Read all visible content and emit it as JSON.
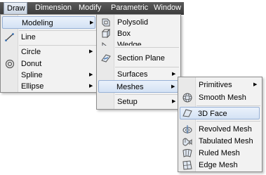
{
  "menubar": {
    "items": [
      {
        "label": "Draw"
      },
      {
        "label": "Dimension"
      },
      {
        "label": "Modify"
      },
      {
        "label": "Parametric"
      },
      {
        "label": "Window"
      }
    ]
  },
  "draw_menu": {
    "items": [
      {
        "label": "Modeling",
        "submenu": true
      },
      {
        "label": "Line",
        "icon": "line-icon"
      },
      {
        "label": "Circle",
        "submenu": true
      },
      {
        "label": "Donut",
        "icon": "donut-icon"
      },
      {
        "label": "Spline",
        "submenu": true
      },
      {
        "label": "Ellipse",
        "submenu": true
      }
    ]
  },
  "modeling_menu": {
    "items": [
      {
        "label": "Polysolid",
        "icon": "polysolid-icon"
      },
      {
        "label": "Box",
        "icon": "box-icon"
      },
      {
        "label": "Wedge",
        "icon": "wedge-icon"
      },
      {
        "label": "Section Plane",
        "icon": "section-plane-icon"
      },
      {
        "label": "Surfaces",
        "submenu": true
      },
      {
        "label": "Meshes",
        "submenu": true
      },
      {
        "label": "Setup",
        "submenu": true
      }
    ]
  },
  "meshes_menu": {
    "items": [
      {
        "label": "Primitives",
        "submenu": true
      },
      {
        "label": "Smooth Mesh",
        "icon": "smooth-mesh-icon"
      },
      {
        "label": "3D Face",
        "icon": "3d-face-icon"
      },
      {
        "label": "Revolved Mesh",
        "icon": "revolved-mesh-icon"
      },
      {
        "label": "Tabulated Mesh",
        "icon": "tabulated-mesh-icon"
      },
      {
        "label": "Ruled Mesh",
        "icon": "ruled-mesh-icon"
      },
      {
        "label": "Edge Mesh",
        "icon": "edge-mesh-icon"
      }
    ]
  },
  "colors": {
    "menubar_bg": "#4a4a4a",
    "menu_bg": "#f2f2f2",
    "highlight_bg": "#dbe6f5",
    "highlight_border": "#97b1d6"
  }
}
